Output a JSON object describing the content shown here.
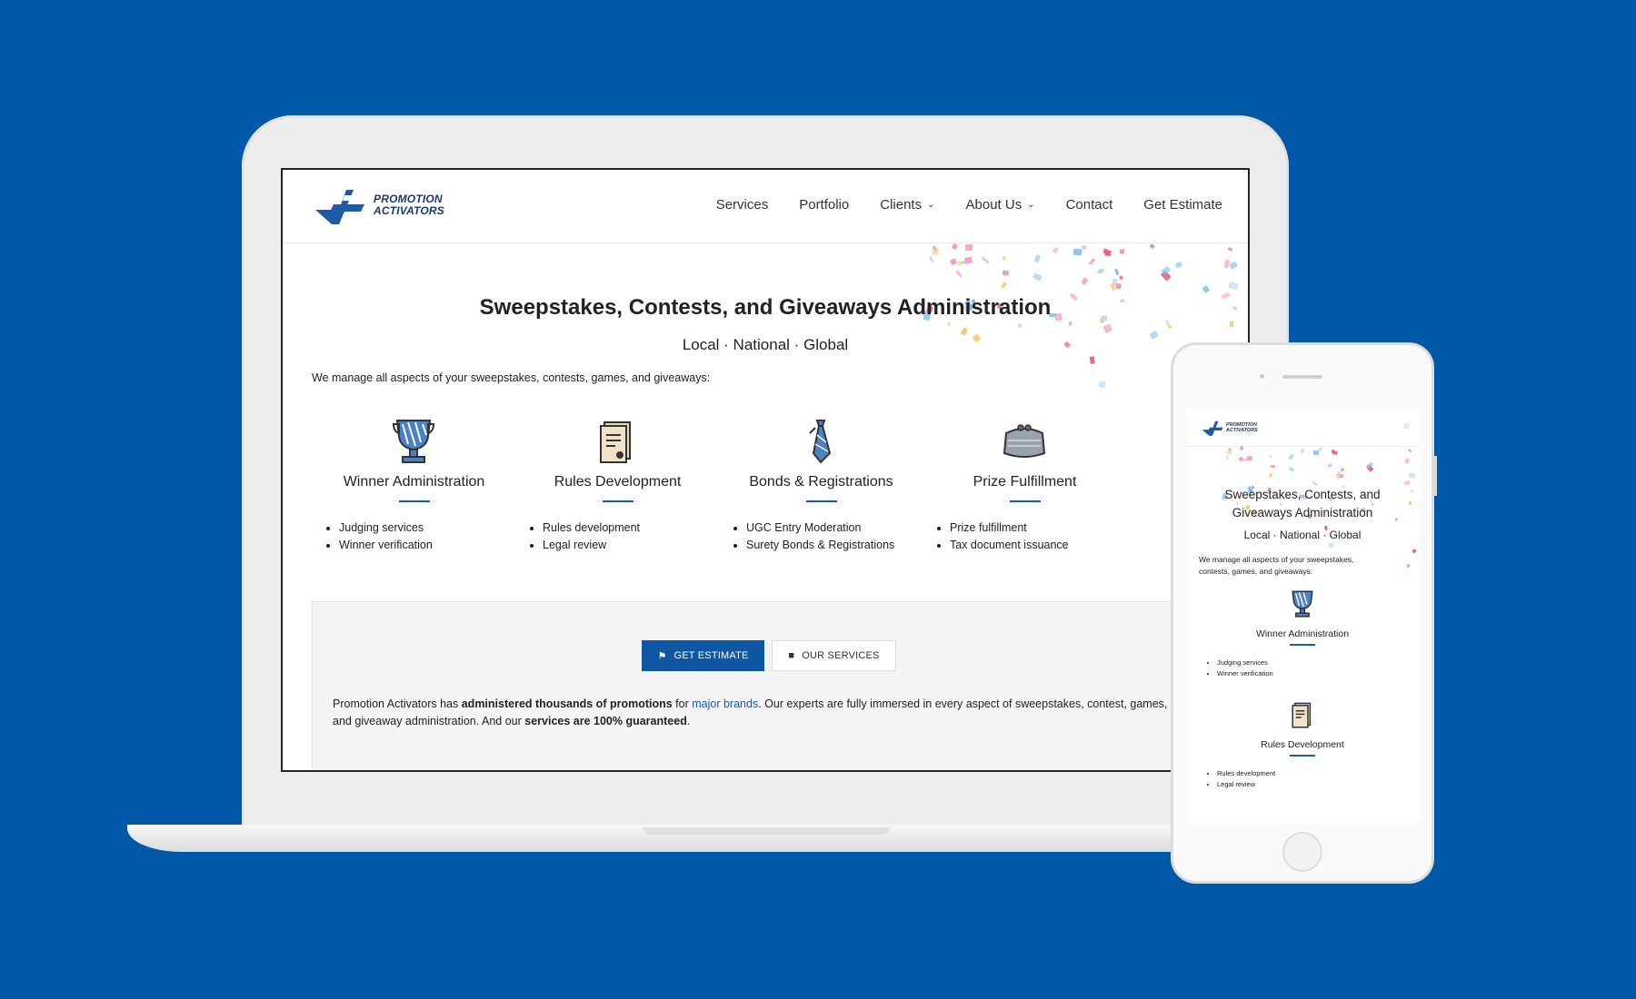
{
  "desktop": {
    "logo": {
      "line1": "PROMOTION",
      "line2": "ACTIVATORS"
    },
    "nav": [
      {
        "label": "Services",
        "caret": ""
      },
      {
        "label": "Portfolio",
        "caret": ""
      },
      {
        "label": "Clients",
        "caret": "⌄"
      },
      {
        "label": "About Us",
        "caret": "⌄"
      },
      {
        "label": "Contact",
        "caret": ""
      },
      {
        "label": "Get Estimate",
        "caret": ""
      }
    ],
    "hero": {
      "title": "Sweepstakes, Contests, and Giveaways Administration",
      "subtitle": "Local · National · Global",
      "intro": "We manage all aspects of your sweepstakes, contests, games, and giveaways:"
    },
    "features": [
      {
        "icon": "trophy-icon",
        "title": "Winner Administration",
        "items": [
          "Judging services",
          "Winner verification"
        ]
      },
      {
        "icon": "document-icon",
        "title": "Rules Development",
        "items": [
          "Rules development",
          "Legal review"
        ]
      },
      {
        "icon": "tie-icon",
        "title": "Bonds & Registrations",
        "items": [
          "UGC Entry Moderation",
          "Surety Bonds & Registrations"
        ]
      },
      {
        "icon": "purse-icon",
        "title": "Prize Fulfillment",
        "items": [
          "Prize fulfillment",
          "Tax document issuance"
        ]
      }
    ],
    "cta": {
      "primary_label": "GET ESTIMATE",
      "secondary_label": "OUR SERVICES",
      "text_1": "Promotion Activators has ",
      "text_2": "administered thousands of promotions",
      "text_3": " for ",
      "text_link": "major brands",
      "text_4": ". Our experts are fully immersed in every aspect of sweepstakes, contest, games,",
      "text_5": "and giveaway administration. And our ",
      "text_6": "services are 100% guaranteed",
      "text_7": "."
    }
  },
  "mobile": {
    "logo": {
      "line1": "PROMOTION",
      "line2": "ACTIVATORS"
    },
    "menu_icon": "≡",
    "title_line1": "Sweepstakes, Contests, and",
    "title_line2": "Giveaways Administration",
    "subtitle": "Local · National · Global",
    "intro_line1": "We manage all aspects of your sweepstakes,",
    "intro_line2": "contests, games, and giveaways:",
    "features": [
      {
        "icon": "trophy-icon",
        "title": "Winner Administration",
        "items": [
          "Judging services",
          "Winner verification"
        ]
      },
      {
        "icon": "document-icon",
        "title": "Rules Development",
        "items": [
          "Rules development",
          "Legal review"
        ]
      }
    ]
  },
  "colors": {
    "background": "#0059a8",
    "accent": "#0d57a5",
    "link": "#1e5aa8"
  }
}
